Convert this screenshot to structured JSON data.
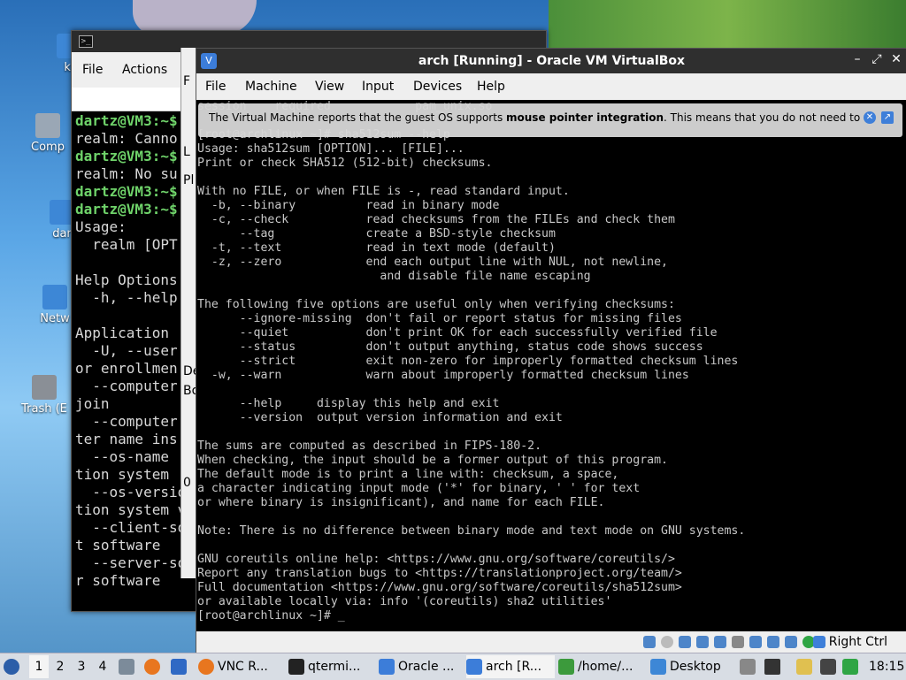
{
  "desktop": {
    "icons": [
      {
        "label": "ki"
      },
      {
        "label": "Comp"
      },
      {
        "label": "dar"
      },
      {
        "label": "Netw"
      },
      {
        "label": "Trash (E"
      }
    ]
  },
  "qterminal": {
    "menu": {
      "file": "File",
      "actions": "Actions"
    },
    "lines": [
      [
        "dartz@VM3:~$",
        ""
      ],
      [
        "",
        "realm: Canno"
      ],
      [
        "dartz@VM3:~$",
        ""
      ],
      [
        "",
        "realm: No su"
      ],
      [
        "dartz@VM3:~$",
        ""
      ],
      [
        "dartz@VM3:~$",
        ""
      ],
      [
        "",
        "Usage:"
      ],
      [
        "",
        "  realm [OPT"
      ],
      [
        "",
        ""
      ],
      [
        "",
        "Help Options"
      ],
      [
        "",
        "  -h, --help"
      ],
      [
        "",
        ""
      ],
      [
        "",
        "Application"
      ],
      [
        "",
        "  -U, --user"
      ],
      [
        "",
        "or enrollmen"
      ],
      [
        "",
        "  --computer"
      ],
      [
        "",
        "join"
      ],
      [
        "",
        "  --computer"
      ],
      [
        "",
        "ter name ins"
      ],
      [
        "",
        "  --os-name"
      ],
      [
        "",
        "tion system"
      ],
      [
        "",
        "  --os-versio"
      ],
      [
        "",
        "tion system ve"
      ],
      [
        "",
        "  --client-sof"
      ],
      [
        "",
        "t software"
      ],
      [
        "",
        "  --server-sof"
      ],
      [
        "",
        "r software"
      ]
    ]
  },
  "filemanager": {
    "fragments": [
      "F",
      "L",
      "Pl",
      "De",
      "Bo",
      "0"
    ]
  },
  "vbox": {
    "title": "arch [Running] - Oracle VM VirtualBox",
    "menu": [
      "File",
      "Machine",
      "View",
      "Input",
      "Devices",
      "Help"
    ],
    "notice": {
      "before": "The Virtual Machine reports that the guest OS supports ",
      "bold": "mouse pointer integration",
      "after": ". This means that you do not need to"
    },
    "screen_lines": [
      "session    required            pam_unix.so",
      "",
      "[root@archlinux ~]# sha512sum --help",
      "Usage: sha512sum [OPTION]... [FILE]...",
      "Print or check SHA512 (512-bit) checksums.",
      "",
      "With no FILE, or when FILE is -, read standard input.",
      "  -b, --binary          read in binary mode",
      "  -c, --check           read checksums from the FILEs and check them",
      "      --tag             create a BSD-style checksum",
      "  -t, --text            read in text mode (default)",
      "  -z, --zero            end each output line with NUL, not newline,",
      "                          and disable file name escaping",
      "",
      "The following five options are useful only when verifying checksums:",
      "      --ignore-missing  don't fail or report status for missing files",
      "      --quiet           don't print OK for each successfully verified file",
      "      --status          don't output anything, status code shows success",
      "      --strict          exit non-zero for improperly formatted checksum lines",
      "  -w, --warn            warn about improperly formatted checksum lines",
      "",
      "      --help     display this help and exit",
      "      --version  output version information and exit",
      "",
      "The sums are computed as described in FIPS-180-2.",
      "When checking, the input should be a former output of this program.",
      "The default mode is to print a line with: checksum, a space,",
      "a character indicating input mode ('*' for binary, ' ' for text",
      "or where binary is insignificant), and name for each FILE.",
      "",
      "Note: There is no difference between binary mode and text mode on GNU systems.",
      "",
      "GNU coreutils online help: <https://www.gnu.org/software/coreutils/>",
      "Report any translation bugs to <https://translationproject.org/team/>",
      "Full documentation <https://www.gnu.org/software/coreutils/sha512sum>",
      "or available locally via: info '(coreutils) sha2 utilities'",
      "[root@archlinux ~]# _"
    ],
    "host_key": "Right Ctrl"
  },
  "taskbar": {
    "workspaces": [
      "1",
      "2",
      "3",
      "4"
    ],
    "tasks": [
      {
        "label": "VNC R..."
      },
      {
        "label": "qtermi..."
      },
      {
        "label": "Oracle ..."
      },
      {
        "label": "arch [R..."
      },
      {
        "label": "/home/..."
      },
      {
        "label": "Desktop"
      }
    ],
    "clock": "18:15"
  },
  "colors": {
    "prompt_green": "#6fd36a",
    "vbox_blue": "#3c7dd9",
    "taskbar_bg": "#d8dde4"
  }
}
